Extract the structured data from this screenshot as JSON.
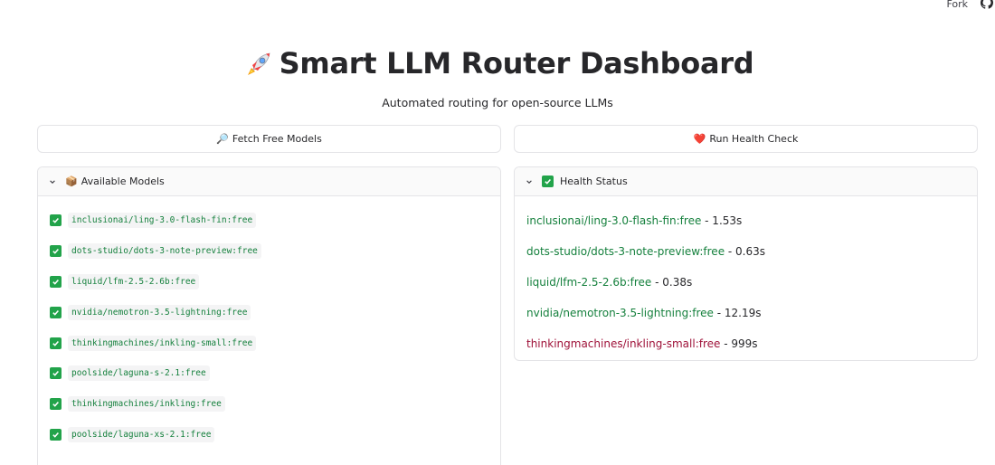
{
  "topbar": {
    "fork_label": "Fork",
    "icon": "github-icon"
  },
  "header": {
    "rocket_icon": "rocket-icon",
    "title": "Smart LLM Router Dashboard",
    "subtitle": "Automated routing for open-source LLMs"
  },
  "buttons": {
    "fetch": {
      "icon": "🔎",
      "label": "Fetch Free Models"
    },
    "health": {
      "icon": "❤️",
      "label": "Run Health Check"
    }
  },
  "models_panel": {
    "icon": "📦",
    "title": "Available Models",
    "items": [
      "inclusionai/ling-3.0-flash-fin:free",
      "dots-studio/dots-3-note-preview:free",
      "liquid/lfm-2.5-2.6b:free",
      "nvidia/nemotron-3.5-lightning:free",
      "thinkingmachines/inkling-small:free",
      "poolside/laguna-s-2.1:free",
      "thinkingmachines/inkling:free",
      "poolside/laguna-xs-2.1:free"
    ]
  },
  "health_panel": {
    "icon": "✅",
    "title": "Health Status",
    "items": [
      {
        "name": "inclusionai/ling-3.0-flash-fin:free",
        "time": " - 1.53s",
        "status": "ok"
      },
      {
        "name": "dots-studio/dots-3-note-preview:free",
        "time": " - 0.63s",
        "status": "ok"
      },
      {
        "name": "liquid/lfm-2.5-2.6b:free",
        "time": " - 0.38s",
        "status": "ok"
      },
      {
        "name": "nvidia/nemotron-3.5-lightning:free",
        "time": " - 12.19s",
        "status": "ok"
      },
      {
        "name": "thinkingmachines/inkling-small:free",
        "time": " - 999s",
        "status": "fail"
      }
    ]
  },
  "colors": {
    "ok": "#15803d",
    "fail": "#9f1239",
    "check_bg": "#22a34a"
  }
}
